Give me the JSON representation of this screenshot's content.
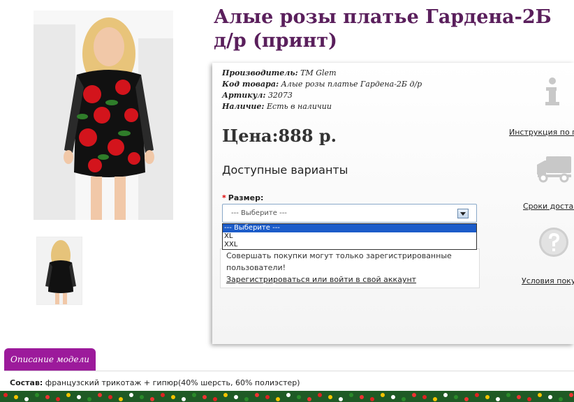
{
  "product": {
    "title": "Алые розы платье Гардена-2Б д/р (принт)",
    "manufacturer_label": "Производитель:",
    "manufacturer_value": "TM Glem",
    "code_label": "Код товара:",
    "code_value": "Алые розы платье Гардена-2Б д/р",
    "article_label": "Артикул:",
    "article_value": "32073",
    "availability_label": "Наличие:",
    "availability_value": "Есть в наличии",
    "price": "Цена:888 р."
  },
  "options": {
    "heading": "Доступные варианты",
    "required_mark": "*",
    "size_label": "Размер:",
    "select_value": "--- Выберите ---",
    "dropdown": [
      "--- Выберите ---",
      "XL",
      "XXL"
    ]
  },
  "notice": {
    "text": "Совершать покупки могут только зарегистрированные пользователи!",
    "link": "Зарегистрироваться или войти в свой аккаунт"
  },
  "side": {
    "instruction": "Инструкция по по",
    "delivery": "Сроки достав",
    "terms": "Условия покуп",
    "icons": [
      "info-icon",
      "truck-icon",
      "question-icon"
    ]
  },
  "tabs": {
    "description": "Описание модели"
  },
  "composition": {
    "label": "Состав:",
    "value": " французский трикотаж + гипюр(40% шерсть, 60% полиэстер)"
  },
  "colors": {
    "title": "#5a1f5c",
    "tab": "#9c1a9b",
    "dropdown_selected": "#1c5cc9"
  }
}
